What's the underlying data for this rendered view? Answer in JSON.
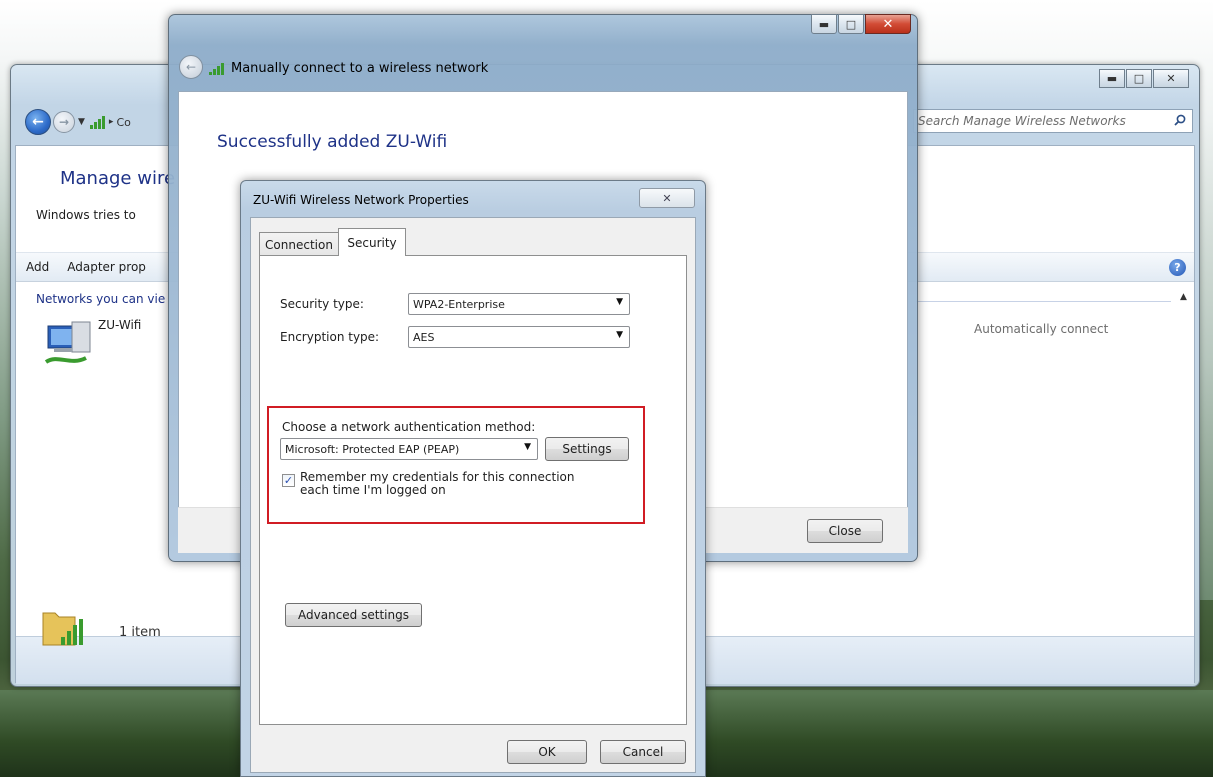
{
  "back_window": {
    "address_crumb": "Co",
    "search_placeholder": "Search Manage Wireless Networks",
    "heading": "Manage wire",
    "subtext": "Windows tries to",
    "toolbar": {
      "add": "Add",
      "adapter": "Adapter prop"
    },
    "group_header": "Networks you can vie",
    "network_name": "ZU-Wifi",
    "auto_connect": "Automatically connect",
    "status_count": "1 item"
  },
  "mid_window": {
    "title": "Manually connect to a wireless network",
    "success_message": "Successfully added ZU-Wifi",
    "close_label": "Close"
  },
  "dialog": {
    "title": "ZU-Wifi Wireless Network Properties",
    "tabs": {
      "connection": "Connection",
      "security": "Security"
    },
    "security_type_label": "Security type:",
    "security_type_value": "WPA2-Enterprise",
    "encryption_type_label": "Encryption type:",
    "encryption_type_value": "AES",
    "auth_method_label": "Choose a network authentication method:",
    "auth_method_value": "Microsoft: Protected EAP (PEAP)",
    "settings_label": "Settings",
    "remember_credentials": "Remember my credentials for this connection each time I'm logged on",
    "remember_checked": true,
    "advanced_label": "Advanced settings",
    "ok_label": "OK",
    "cancel_label": "Cancel"
  },
  "colors": {
    "highlight_border": "#d11c24",
    "heading_blue": "#1e3287",
    "signal_green": "#3a9b2f"
  },
  "icons": {
    "back": "back-arrow-icon",
    "forward": "forward-arrow-icon",
    "search": "search-icon",
    "help": "help-icon",
    "network": "network-computer-icon",
    "folder": "folder-signal-icon",
    "signal": "wireless-signal-icon"
  }
}
